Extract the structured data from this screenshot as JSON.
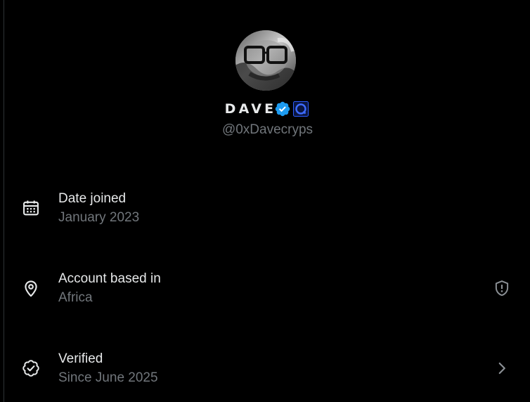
{
  "profile": {
    "display_name": "DAVE",
    "handle": "@0xDavecryps",
    "verified_badge": "blue-checkmark-icon",
    "affiliate_badge": "affiliate-logo-icon"
  },
  "info": {
    "date_joined": {
      "icon": "calendar-icon",
      "title": "Date joined",
      "value": "January 2023"
    },
    "account_based_in": {
      "icon": "location-pin-icon",
      "title": "Account based in",
      "value": "Africa",
      "right_icon": "shield-alert-icon"
    },
    "verified": {
      "icon": "verified-badge-icon",
      "title": "Verified",
      "value": "Since June 2025",
      "right_icon": "chevron-right-icon"
    }
  },
  "colors": {
    "background": "#000000",
    "primary_text": "#e7e9ea",
    "secondary_text": "#71767b",
    "verified_blue": "#1d9bf0",
    "affiliate_blue": "#1a3fff"
  }
}
